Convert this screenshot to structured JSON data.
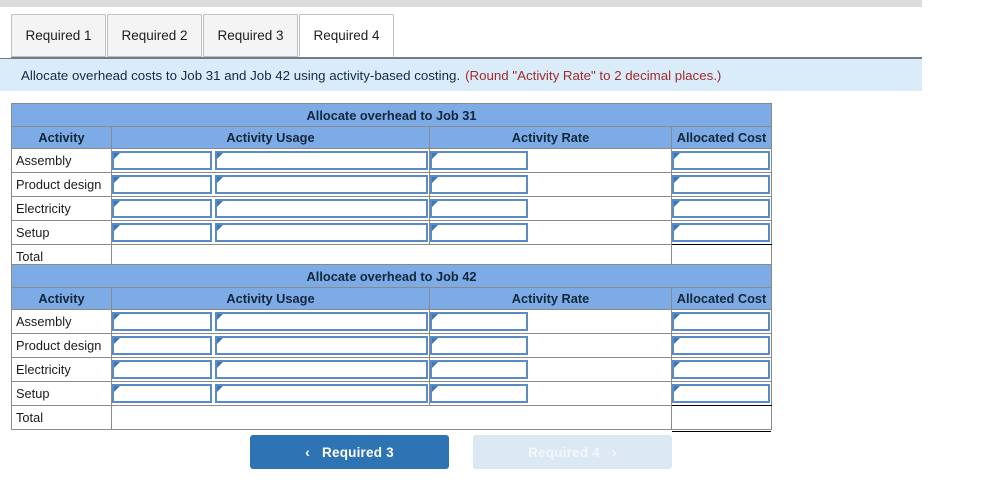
{
  "top_strip": {
    "color": "#dddddd"
  },
  "tabs": [
    {
      "label": "Required 1",
      "active": false
    },
    {
      "label": "Required 2",
      "active": false
    },
    {
      "label": "Required 3",
      "active": false
    },
    {
      "label": "Required 4",
      "active": true
    }
  ],
  "instruction": {
    "text": "Allocate overhead costs to Job 31 and Job 42 using activity-based costing.",
    "hint": "(Round \"Activity Rate\" to 2 decimal places.)",
    "hint_color": "#9e2b2b",
    "background": "#daecf9"
  },
  "tables": [
    {
      "title": "Allocate overhead to Job 31",
      "columns": [
        "Activity",
        "Activity Usage",
        "Activity Rate",
        "Allocated Cost"
      ],
      "rows": [
        {
          "activity": "Assembly",
          "usage": "",
          "rate": "",
          "allocated": ""
        },
        {
          "activity": "Product design",
          "usage": "",
          "rate": "",
          "allocated": ""
        },
        {
          "activity": "Electricity",
          "usage": "",
          "rate": "",
          "allocated": ""
        },
        {
          "activity": "Setup",
          "usage": "",
          "rate": "",
          "allocated": ""
        }
      ],
      "total_label": "Total",
      "total_value": ""
    },
    {
      "title": "Allocate overhead to Job 42",
      "columns": [
        "Activity",
        "Activity Usage",
        "Activity Rate",
        "Allocated Cost"
      ],
      "rows": [
        {
          "activity": "Assembly",
          "usage": "",
          "rate": "",
          "allocated": ""
        },
        {
          "activity": "Product design",
          "usage": "",
          "rate": "",
          "allocated": ""
        },
        {
          "activity": "Electricity",
          "usage": "",
          "rate": "",
          "allocated": ""
        },
        {
          "activity": "Setup",
          "usage": "",
          "rate": "",
          "allocated": ""
        }
      ],
      "total_label": "Total",
      "total_value": ""
    }
  ],
  "nav": {
    "prev": {
      "label": "Required 3",
      "icon": "chevron-left-icon",
      "glyph": "‹",
      "enabled": true,
      "color": "#2e74b5"
    },
    "next": {
      "label": "Required 4",
      "icon": "chevron-right-icon",
      "glyph": "›",
      "enabled": false,
      "color": "#dce8f4"
    }
  },
  "theme": {
    "header_blue": "#7cabe5",
    "input_border": "#5a8bc4",
    "marker_blue": "#3c78b4",
    "grid_gray": "#8a8a8a"
  }
}
